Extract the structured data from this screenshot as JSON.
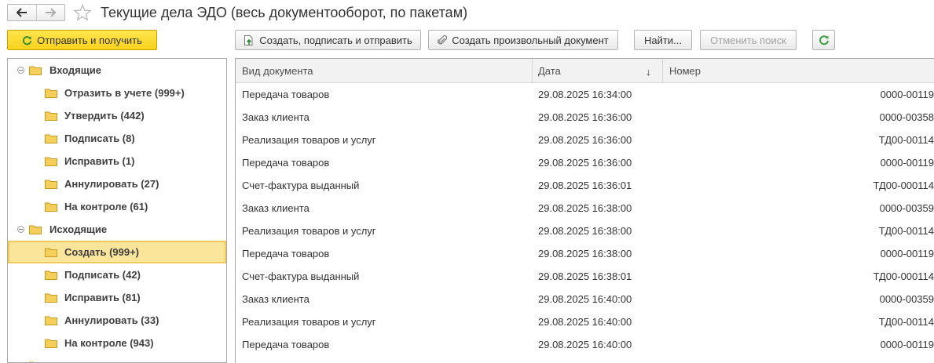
{
  "window": {
    "title": "Текущие дела ЭДО (весь документооборот, по пакетам)"
  },
  "colors": {
    "primary_button": "#f7d11a",
    "selection": "#fbe59a",
    "folder": "#f1c24a",
    "refresh_green": "#3aa142"
  },
  "toolbar": {
    "send_receive": "Отправить и получить",
    "create_sign_send": "Создать, подписать и отправить",
    "create_arbitrary": "Создать произвольный документ",
    "find": "Найти...",
    "cancel_search": "Отменить поиск"
  },
  "tree": {
    "incoming": {
      "label": "Входящие",
      "items": [
        "Отразить в учете (999+)",
        "Утвердить (442)",
        "Подписать (8)",
        "Исправить (1)",
        "Аннулировать (27)",
        "На контроле (61)"
      ]
    },
    "outgoing": {
      "label": "Исходящие",
      "items": [
        "Создать (999+)",
        "Подписать (42)",
        "Исправить (81)",
        "Аннулировать (33)",
        "На контроле (943)"
      ]
    },
    "selected": "Создать (999+)"
  },
  "table": {
    "columns": [
      "Вид документа",
      "Дата",
      "Номер"
    ],
    "sort_indicator": "↓",
    "rows": [
      {
        "kind": "Передача товаров",
        "date": "29.08.2025 16:34:00",
        "number": "0000-00119"
      },
      {
        "kind": "Заказ клиента",
        "date": "29.08.2025 16:36:00",
        "number": "0000-00358"
      },
      {
        "kind": "Реализация товаров и услуг",
        "date": "29.08.2025 16:36:00",
        "number": "ТД00-00114"
      },
      {
        "kind": "Передача товаров",
        "date": "29.08.2025 16:36:00",
        "number": "0000-00119"
      },
      {
        "kind": "Счет-фактура выданный",
        "date": "29.08.2025 16:36:01",
        "number": "ТД00-000114"
      },
      {
        "kind": "Заказ клиента",
        "date": "29.08.2025 16:38:00",
        "number": "0000-00359"
      },
      {
        "kind": "Реализация товаров и услуг",
        "date": "29.08.2025 16:38:00",
        "number": "ТД00-00114"
      },
      {
        "kind": "Передача товаров",
        "date": "29.08.2025 16:38:00",
        "number": "0000-00119"
      },
      {
        "kind": "Счет-фактура выданный",
        "date": "29.08.2025 16:38:01",
        "number": "ТД00-000114"
      },
      {
        "kind": "Заказ клиента",
        "date": "29.08.2025 16:40:00",
        "number": "0000-00359"
      },
      {
        "kind": "Реализация товаров и услуг",
        "date": "29.08.2025 16:40:00",
        "number": "ТД00-00114"
      },
      {
        "kind": "Передача товаров",
        "date": "29.08.2025 16:40:00",
        "number": "0000-00119"
      }
    ]
  }
}
